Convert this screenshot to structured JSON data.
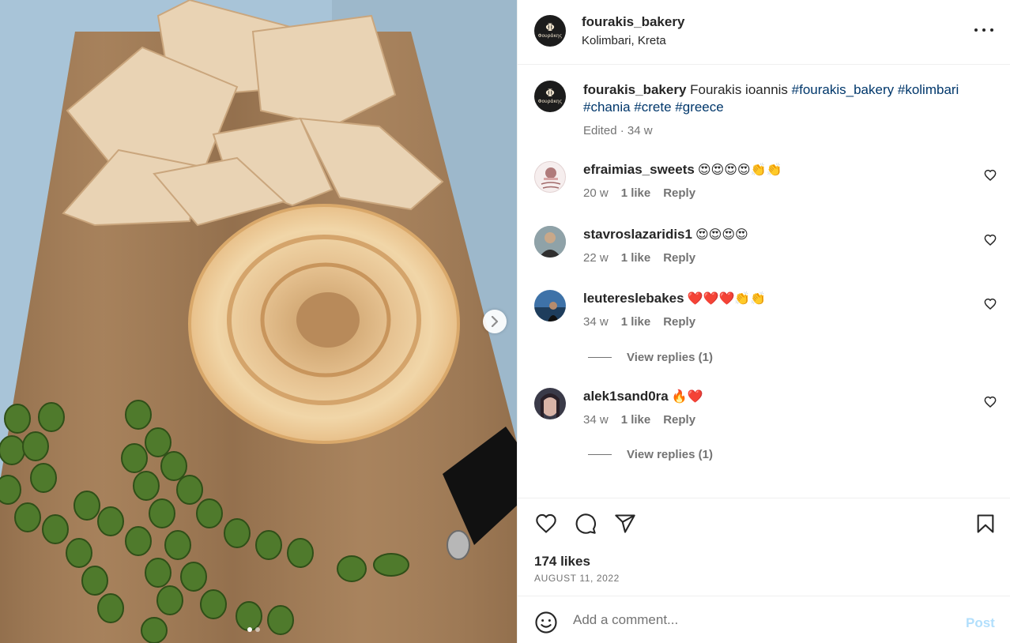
{
  "post": {
    "username": "fourakis_bakery",
    "location": "Kolimbari, Kreta",
    "avatar_glyph": "Φ",
    "avatar_brand": "Φουράκης"
  },
  "caption": {
    "username": "fourakis_bakery",
    "text": "Fourakis ioannis",
    "hashtags": [
      "#fourakis_bakery",
      "#kolimbari",
      "#chania",
      "#crete",
      "#greece"
    ],
    "edited": "Edited",
    "separator": "·",
    "time": "34 w"
  },
  "comments": [
    {
      "username": "efraimias_sweets",
      "text": "😍😍😍😍👏👏",
      "time": "20 w",
      "likes": "1 like",
      "reply": "Reply",
      "avatar": "efraimias-logo"
    },
    {
      "username": "stavroslazaridis1",
      "text": "😍😍😍😍",
      "time": "22 w",
      "likes": "1 like",
      "reply": "Reply",
      "avatar": "man-photo"
    },
    {
      "username": "leutereslebakes",
      "text": "❤️❤️❤️👏👏",
      "time": "34 w",
      "likes": "1 like",
      "reply": "Reply",
      "avatar": "sea-photo",
      "view_replies": "View replies (1)"
    },
    {
      "username": "alek1sand0ra",
      "text": "🔥❤️",
      "time": "34 w",
      "likes": "1 like",
      "reply": "Reply",
      "avatar": "woman-photo",
      "view_replies": "View replies (1)"
    }
  ],
  "stats": {
    "likes": "174 likes",
    "date": "AUGUST 11, 2022"
  },
  "add_comment": {
    "placeholder": "Add a comment...",
    "post_label": "Post"
  },
  "carousel": {
    "current": 1,
    "total": 2
  },
  "colors": {
    "text": "#262626",
    "secondary": "#737373",
    "hashtag": "#00376b",
    "post_disabled": "#b2dffc",
    "border": "#efefef"
  },
  "icons": [
    "chevron-right-icon",
    "more-icon",
    "heart-icon",
    "comment-icon",
    "share-icon",
    "bookmark-icon",
    "emoji-icon"
  ]
}
